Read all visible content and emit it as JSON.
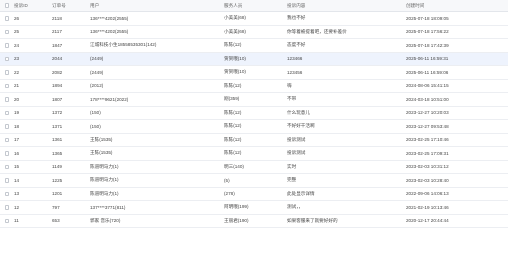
{
  "columns": {
    "id": "投诉ID",
    "order": "订单号",
    "user": "用户",
    "staff": "服务人员",
    "content": "投诉内容",
    "time": "创建时间"
  },
  "rows": [
    {
      "id": "26",
      "order": "2118",
      "user": "136****4202(2555)",
      "staff": "小美美(68)",
      "content": "我也不好",
      "time": "2025-07-18 18:09:05"
    },
    {
      "id": "25",
      "order": "2117",
      "user": "136****4202(2555)",
      "staff": "小美美(68)",
      "content": "你等着被提着吧，还要补差价",
      "time": "2025-07-18 17:56:22"
    },
    {
      "id": "24",
      "order": "1847",
      "user": "江城科技小生18558535301(142)",
      "staff": "陈陈(12)",
      "content": "态度不好",
      "time": "2025-07-18 17:42:39"
    },
    {
      "id": "23",
      "order": "2044",
      "user": "(2449)",
      "staff": "贺贺哦(10)",
      "content": "123466",
      "time": "2025-06-11 16:59:31",
      "highlight": true
    },
    {
      "id": "22",
      "order": "2082",
      "user": "(2449)",
      "staff": "贺贺哦(10)",
      "content": "123456",
      "time": "2025-06-11 16:59:06"
    },
    {
      "id": "21",
      "order": "1894",
      "user": "(2012)",
      "staff": "陈陈(12)",
      "content": "嗨",
      "time": "2024-08-06 15:41:15"
    },
    {
      "id": "20",
      "order": "1807",
      "user": "178****9621(2022)",
      "staff": "刚(359)",
      "content": "不带",
      "time": "2024-03-18 10:51:00"
    },
    {
      "id": "19",
      "order": "1372",
      "user": "(150)",
      "staff": "陈陈(12)",
      "content": "什么玩意儿",
      "time": "2023-12-27 10:20:03"
    },
    {
      "id": "18",
      "order": "1371",
      "user": "(150)",
      "staff": "陈陈(12)",
      "content": "不好好干活啊",
      "time": "2023-12-27 09:53:48"
    },
    {
      "id": "17",
      "order": "1361",
      "user": "王陈(1535)",
      "staff": "陈陈(12)",
      "content": "投诉测试",
      "time": "2023-02-25 17:10:46"
    },
    {
      "id": "16",
      "order": "1365",
      "user": "王陈(1535)",
      "staff": "陈陈(12)",
      "content": "投诉测试",
      "time": "2023-02-25 17:09:31"
    },
    {
      "id": "15",
      "order": "1149",
      "user": "陈道明马力(1)",
      "staff": "明三(140)",
      "content": "实时",
      "time": "2023-02-03 10:31:12"
    },
    {
      "id": "14",
      "order": "1225",
      "user": "陈道明马力(1)",
      "staff": "(5)",
      "content": "完整",
      "time": "2023-02-03 10:28:40"
    },
    {
      "id": "13",
      "order": "1201",
      "user": "陈道明马力(1)",
      "staff": "(278)",
      "content": "此处显示详情",
      "time": "2022-09-06 14:06:13"
    },
    {
      "id": "12",
      "order": "797",
      "user": "137****3771(811)",
      "staff": "阿明哦(199)",
      "content": "测试，，",
      "time": "2021-02-19 10:13:46"
    },
    {
      "id": "11",
      "order": "653",
      "user": "郭家 音乐(720)",
      "staff": "王丽君(190)",
      "content": "如果客服来了就要好好的",
      "time": "2020-12-17 20:44:44"
    }
  ]
}
